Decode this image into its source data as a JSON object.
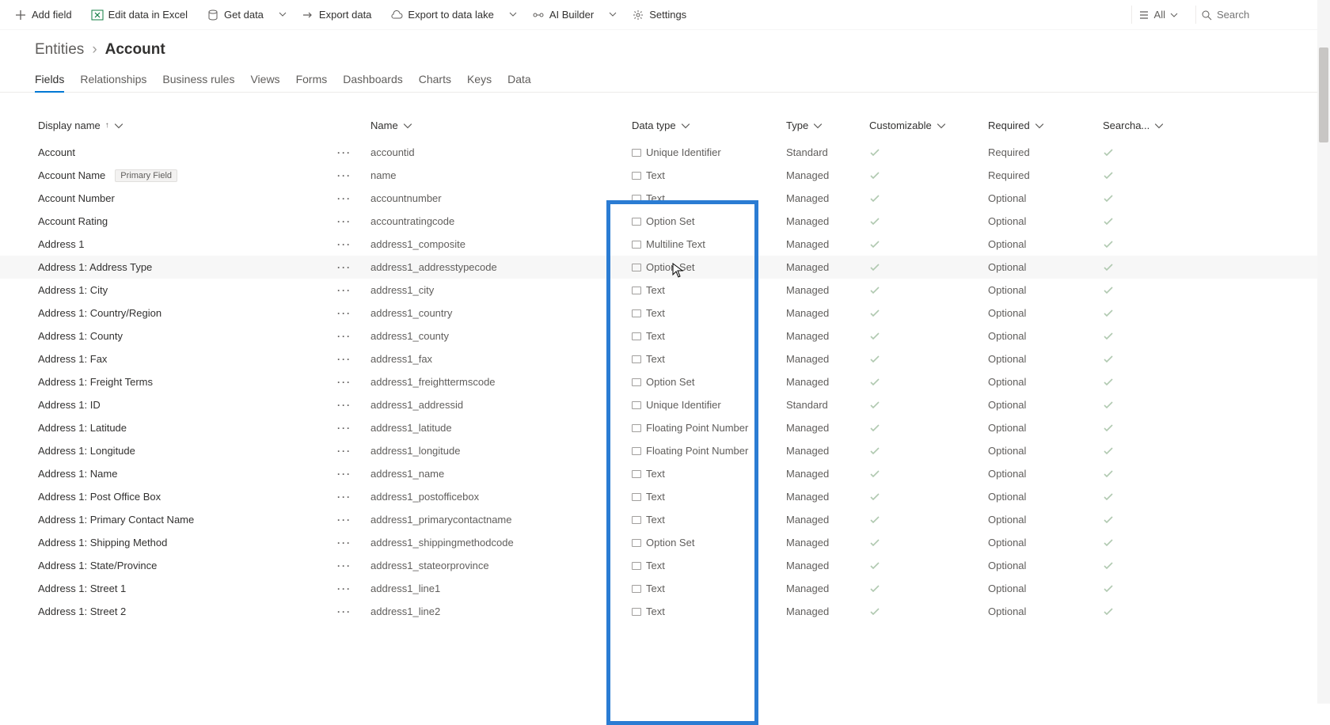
{
  "toolbar": {
    "add_field": "Add field",
    "edit_excel": "Edit data in Excel",
    "get_data": "Get data",
    "export_data": "Export data",
    "export_lake": "Export to data lake",
    "ai_builder": "AI Builder",
    "settings": "Settings",
    "all": "All",
    "search_placeholder": "Search"
  },
  "breadcrumb": {
    "root": "Entities",
    "current": "Account"
  },
  "tabs": [
    "Fields",
    "Relationships",
    "Business rules",
    "Views",
    "Forms",
    "Dashboards",
    "Charts",
    "Keys",
    "Data"
  ],
  "active_tab": 0,
  "columns": {
    "display": "Display name",
    "name": "Name",
    "datatype": "Data type",
    "type": "Type",
    "custom": "Customizable",
    "required": "Required",
    "search": "Searcha..."
  },
  "badge_primary": "Primary Field",
  "hovered_row": 5,
  "rows": [
    {
      "display": "Account",
      "name": "accountid",
      "datatype": "Unique Identifier",
      "type": "Standard",
      "custom": true,
      "required": "Required",
      "search": true
    },
    {
      "display": "Account Name",
      "primary": true,
      "name": "name",
      "datatype": "Text",
      "type": "Managed",
      "custom": true,
      "required": "Required",
      "search": true
    },
    {
      "display": "Account Number",
      "name": "accountnumber",
      "datatype": "Text",
      "type": "Managed",
      "custom": true,
      "required": "Optional",
      "search": true
    },
    {
      "display": "Account Rating",
      "name": "accountratingcode",
      "datatype": "Option Set",
      "type": "Managed",
      "custom": true,
      "required": "Optional",
      "search": true
    },
    {
      "display": "Address 1",
      "name": "address1_composite",
      "datatype": "Multiline Text",
      "type": "Managed",
      "custom": true,
      "required": "Optional",
      "search": true
    },
    {
      "display": "Address 1: Address Type",
      "name": "address1_addresstypecode",
      "datatype": "Option Set",
      "type": "Managed",
      "custom": true,
      "required": "Optional",
      "search": true
    },
    {
      "display": "Address 1: City",
      "name": "address1_city",
      "datatype": "Text",
      "type": "Managed",
      "custom": true,
      "required": "Optional",
      "search": true
    },
    {
      "display": "Address 1: Country/Region",
      "name": "address1_country",
      "datatype": "Text",
      "type": "Managed",
      "custom": true,
      "required": "Optional",
      "search": true
    },
    {
      "display": "Address 1: County",
      "name": "address1_county",
      "datatype": "Text",
      "type": "Managed",
      "custom": true,
      "required": "Optional",
      "search": true
    },
    {
      "display": "Address 1: Fax",
      "name": "address1_fax",
      "datatype": "Text",
      "type": "Managed",
      "custom": true,
      "required": "Optional",
      "search": true
    },
    {
      "display": "Address 1: Freight Terms",
      "name": "address1_freighttermscode",
      "datatype": "Option Set",
      "type": "Managed",
      "custom": true,
      "required": "Optional",
      "search": true
    },
    {
      "display": "Address 1: ID",
      "name": "address1_addressid",
      "datatype": "Unique Identifier",
      "type": "Standard",
      "custom": true,
      "required": "Optional",
      "search": true
    },
    {
      "display": "Address 1: Latitude",
      "name": "address1_latitude",
      "datatype": "Floating Point Number",
      "type": "Managed",
      "custom": true,
      "required": "Optional",
      "search": true
    },
    {
      "display": "Address 1: Longitude",
      "name": "address1_longitude",
      "datatype": "Floating Point Number",
      "type": "Managed",
      "custom": true,
      "required": "Optional",
      "search": true
    },
    {
      "display": "Address 1: Name",
      "name": "address1_name",
      "datatype": "Text",
      "type": "Managed",
      "custom": true,
      "required": "Optional",
      "search": true
    },
    {
      "display": "Address 1: Post Office Box",
      "name": "address1_postofficebox",
      "datatype": "Text",
      "type": "Managed",
      "custom": true,
      "required": "Optional",
      "search": true
    },
    {
      "display": "Address 1: Primary Contact Name",
      "name": "address1_primarycontactname",
      "datatype": "Text",
      "type": "Managed",
      "custom": true,
      "required": "Optional",
      "search": true
    },
    {
      "display": "Address 1: Shipping Method",
      "name": "address1_shippingmethodcode",
      "datatype": "Option Set",
      "type": "Managed",
      "custom": true,
      "required": "Optional",
      "search": true
    },
    {
      "display": "Address 1: State/Province",
      "name": "address1_stateorprovince",
      "datatype": "Text",
      "type": "Managed",
      "custom": true,
      "required": "Optional",
      "search": true
    },
    {
      "display": "Address 1: Street 1",
      "name": "address1_line1",
      "datatype": "Text",
      "type": "Managed",
      "custom": true,
      "required": "Optional",
      "search": true
    },
    {
      "display": "Address 1: Street 2",
      "name": "address1_line2",
      "datatype": "Text",
      "type": "Managed",
      "custom": true,
      "required": "Optional",
      "search": true
    }
  ]
}
